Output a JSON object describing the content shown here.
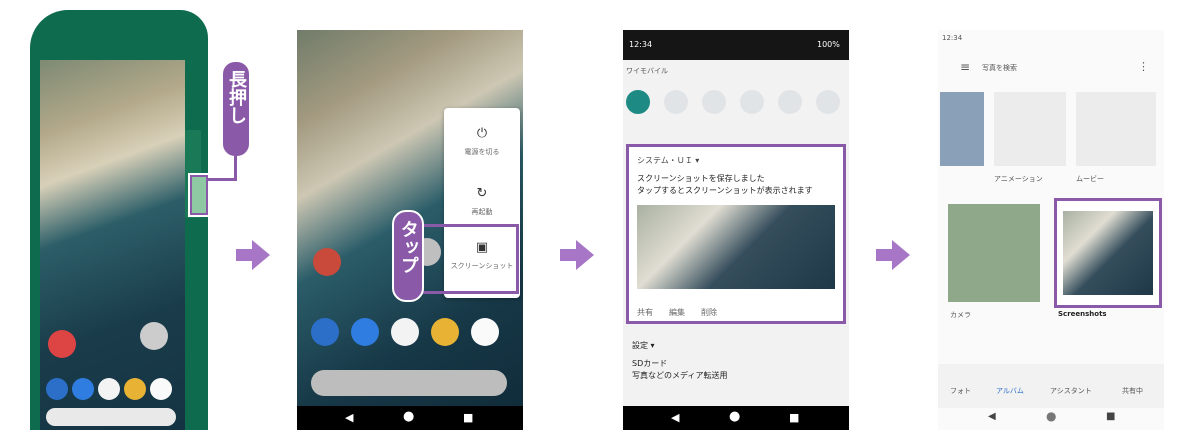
{
  "panel1": {
    "callout": "長押し"
  },
  "panel2": {
    "callout": "タップ",
    "power_menu": {
      "item1": "電源を切る",
      "item2": "再起動",
      "item3": "スクリーンショット"
    }
  },
  "panel3": {
    "status_time": "12:34",
    "status_battery": "100%",
    "carrier": "ワイモバイル",
    "notif_app": "システム・ＵＩ ▾",
    "notif_line1": "スクリーンショットを保存しました",
    "notif_line2": "タップするとスクリーンショットが表示されます",
    "action_share": "共有",
    "action_edit": "編集",
    "action_delete": "削除",
    "notif2_app": "設定 ▾",
    "notif2_line1": "SDカード",
    "notif2_line2": "写真などのメディア転送用"
  },
  "panel4": {
    "status_time": "12:34",
    "search_placeholder": "写真を検索",
    "album_animation": "アニメーション",
    "album_movie": "ムービー",
    "album_camera": "カメラ",
    "album_screenshots": "Screenshots",
    "nav_photos": "フォト",
    "nav_albums": "アルバム",
    "nav_assistant": "アシスタント",
    "nav_sharing": "共有中"
  },
  "colors": {
    "accent_purple": "#8a5aa8",
    "arrow": "#a776c7"
  }
}
